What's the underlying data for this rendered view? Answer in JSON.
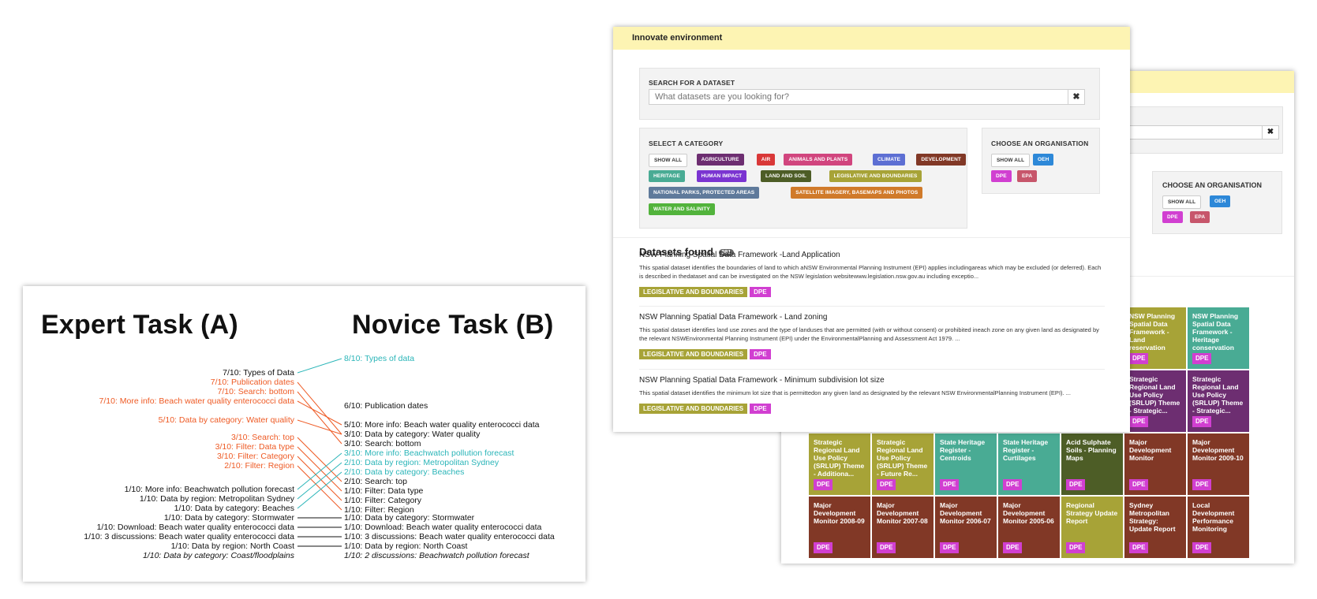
{
  "task_panel": {
    "expert_title": "Expert Task (A)",
    "novice_title": "Novice Task (B)",
    "colors": {
      "orange": "#ee5a24",
      "teal": "#2ab5b8",
      "black": "#111111"
    },
    "expert": [
      {
        "text": "7/10: Types of Data",
        "color": "black"
      },
      {
        "text": "7/10: Publication dates",
        "color": "orange"
      },
      {
        "text": "7/10: Search: bottom",
        "color": "orange"
      },
      {
        "text": "7/10: More info: Beach water quality enterococci data",
        "color": "orange"
      },
      {
        "text": "5/10: Data by category: Water quality",
        "color": "orange"
      },
      {
        "text": "3/10: Search: top",
        "color": "orange"
      },
      {
        "text": "3/10: Filter: Data type",
        "color": "orange"
      },
      {
        "text": "3/10: Filter: Category",
        "color": "orange"
      },
      {
        "text": "2/10: Filter: Region",
        "color": "orange"
      },
      {
        "text": "1/10: More info: Beachwatch pollution forecast",
        "color": "black"
      },
      {
        "text": "1/10: Data by region: Metropolitan Sydney",
        "color": "black"
      },
      {
        "text": "1/10: Data by category: Beaches",
        "color": "black"
      },
      {
        "text": "1/10: Data by category: Stormwater",
        "color": "black"
      },
      {
        "text": "1/10: Download: Beach water quality enterococci data",
        "color": "black"
      },
      {
        "text": "1/10: 3 discussions: Beach water quality enterococci data",
        "color": "black"
      },
      {
        "text": "1/10: Data by region: North Coast",
        "color": "black"
      },
      {
        "text": "1/10: Data by category: Coast/floodplains",
        "color": "black",
        "italic": true
      }
    ],
    "novice": [
      {
        "text": "8/10: Types of data",
        "color": "teal"
      },
      {
        "text": "6/10: Publication dates",
        "color": "black"
      },
      {
        "text": "5/10: More info: Beach water quality enterococci data",
        "color": "black"
      },
      {
        "text": "3/10: Data by category: Water quality",
        "color": "black"
      },
      {
        "text": "3/10: Search: bottom",
        "color": "black"
      },
      {
        "text": "3/10: More info: Beachwatch pollution forecast",
        "color": "teal"
      },
      {
        "text": "2/10: Data by region: Metropolitan Sydney",
        "color": "teal"
      },
      {
        "text": "2/10: Data by category: Beaches",
        "color": "teal"
      },
      {
        "text": "2/10: Search: top",
        "color": "black"
      },
      {
        "text": "1/10: Filter: Data type",
        "color": "black"
      },
      {
        "text": "1/10: Filter: Category",
        "color": "black"
      },
      {
        "text": "1/10: Filter: Region",
        "color": "black"
      },
      {
        "text": "1/10: Data by category: Stormwater",
        "color": "black"
      },
      {
        "text": "1/10: Download: Beach water quality enterococci data",
        "color": "black"
      },
      {
        "text": "1/10: 3 discussions: Beach water quality enterococci data",
        "color": "black"
      },
      {
        "text": "1/10: Data by region: North Coast",
        "color": "black"
      },
      {
        "text": "1/10: 2 discussions: Beachwatch pollution forecast",
        "color": "black",
        "italic": true
      }
    ],
    "connections": [
      {
        "from": 0,
        "to": 0,
        "color": "teal"
      },
      {
        "from": 1,
        "to": 3,
        "color": "orange"
      },
      {
        "from": 2,
        "to": 4,
        "color": "orange"
      },
      {
        "from": 3,
        "to": 2,
        "color": "orange"
      },
      {
        "from": 4,
        "to": 3,
        "color": "orange"
      },
      {
        "from": 5,
        "to": 8,
        "color": "orange"
      },
      {
        "from": 6,
        "to": 9,
        "color": "orange"
      },
      {
        "from": 7,
        "to": 10,
        "color": "orange"
      },
      {
        "from": 8,
        "to": 11,
        "color": "orange"
      },
      {
        "from": 9,
        "to": 5,
        "color": "teal"
      },
      {
        "from": 10,
        "to": 6,
        "color": "teal"
      },
      {
        "from": 11,
        "to": 7,
        "color": "teal"
      },
      {
        "from": 12,
        "to": 12,
        "color": "black"
      },
      {
        "from": 13,
        "to": 13,
        "color": "black"
      },
      {
        "from": 14,
        "to": 14,
        "color": "black"
      },
      {
        "from": 15,
        "to": 15,
        "color": "black"
      }
    ]
  },
  "front": {
    "header_title": "Innovate environment",
    "search_label": "SEARCH FOR A DATASET",
    "search_placeholder": "What datasets are you looking for?",
    "clear_icon": "✖",
    "category_label": "SELECT A CATEGORY",
    "categories": [
      {
        "label": "SHOW ALL",
        "color": "#ffffff",
        "outline": true
      },
      {
        "label": "AGRICULTURE",
        "color": "#6d2e71"
      },
      {
        "label": "AIR",
        "color": "#d93838"
      },
      {
        "label": "ANIMALS AND PLANTS",
        "color": "#d1457e"
      },
      {
        "label": "CLIMATE",
        "color": "#5d6fd3"
      },
      {
        "label": "DEVELOPMENT",
        "color": "#813826"
      },
      {
        "label": "HERITAGE",
        "color": "#49ab94"
      },
      {
        "label": "HUMAN IMPACT",
        "color": "#7b34d1"
      },
      {
        "label": "LAND AND SOIL",
        "color": "#4d5d26"
      },
      {
        "label": "LEGISLATIVE AND BOUNDARIES",
        "color": "#a7a337"
      },
      {
        "label": "NATIONAL PARKS, PROTECTED AREAS",
        "color": "#5f7a9b"
      },
      {
        "label": "SATELLITE IMAGERY, BASEMAPS AND PHOTOS",
        "color": "#d07a2a"
      },
      {
        "label": "WATER AND SALINITY",
        "color": "#52b33c"
      }
    ],
    "org_label": "CHOOSE AN ORGANISATION",
    "orgs": [
      {
        "label": "SHOW ALL",
        "color": "#ffffff",
        "outline": true
      },
      {
        "label": "OEH",
        "color": "#2d88d8"
      },
      {
        "label": "DPE",
        "color": "#d13fd1"
      },
      {
        "label": "EPA",
        "color": "#c7566b"
      }
    ],
    "datasets_heading": "Datasets found",
    "datasets_count": "981",
    "datasets": [
      {
        "title": "NSW Planning Spatial Data Framework -Land Application",
        "desc": "This spatial dataset identifies the boundaries of land to which aNSW Environmental Planning Instrument (EPI) applies includingareas which may be excluded (or deferred). Each is described in thedataset and can be investigated on the NSW legislation websitewww.legislation.nsw.gov.au including exceptio...",
        "tags": [
          {
            "label": "LEGISLATIVE AND BOUNDARIES",
            "color": "#a7a337"
          },
          {
            "label": "DPE",
            "color": "#d13fd1"
          }
        ]
      },
      {
        "title": "NSW Planning Spatial Data Framework - Land zoning",
        "desc": "This spatial dataset identifies land use zones and the type of landuses that are permitted (with or without consent) or prohibited ineach zone on any given land as designated by the relevant NSWEnvironmental Planning Instrument (EPI) under the EnvironmentalPlanning and Assessment Act 1979. ...",
        "tags": [
          {
            "label": "LEGISLATIVE AND BOUNDARIES",
            "color": "#a7a337"
          },
          {
            "label": "DPE",
            "color": "#d13fd1"
          }
        ]
      },
      {
        "title": "NSW Planning Spatial Data Framework - Minimum subdivision lot size",
        "desc": "This spatial dataset identifies the minimum lot size that is permittedon any given land as designated by the relevant NSW EnvironmentalPlanning Instrument (EPI). ...",
        "tags": [
          {
            "label": "LEGISLATIVE AND BOUNDARIES",
            "color": "#a7a337"
          },
          {
            "label": "DPE",
            "color": "#d13fd1"
          }
        ]
      }
    ]
  },
  "back": {
    "clear_icon": "✖",
    "org_label": "CHOOSE AN ORGANISATION",
    "orgs": [
      {
        "label": "SHOW ALL",
        "color": "#ffffff",
        "outline": true
      },
      {
        "label": "OEH",
        "color": "#2d88d8"
      },
      {
        "label": "DPE",
        "color": "#d13fd1"
      },
      {
        "label": "EPA",
        "color": "#c7566b"
      }
    ],
    "tiles": [
      {
        "row": 0,
        "col": 4,
        "title": "",
        "badge": "DPE",
        "color": "olive"
      },
      {
        "row": 0,
        "col": 5,
        "title": "NSW Planning Spatial Data Framework - Land reservation",
        "badge": "DPE",
        "color": "olive"
      },
      {
        "row": 0,
        "col": 6,
        "title": "NSW Planning Spatial Data Framework - Heritage conservation",
        "badge": "DPE",
        "color": "teal"
      },
      {
        "row": 1,
        "col": 5,
        "title": "Strategic Regional Land Use Policy (SRLUP) Theme - Strategic...",
        "badge": "DPE",
        "color": "purple"
      },
      {
        "row": 1,
        "col": 6,
        "title": "Strategic Regional Land Use Policy (SRLUP) Theme - Strategic...",
        "badge": "DPE",
        "color": "purple"
      },
      {
        "row": 2,
        "col": 0,
        "title": "Strategic Regional Land Use Policy (SRLUP) Theme - Additiona...",
        "badge": "DPE",
        "color": "olive"
      },
      {
        "row": 2,
        "col": 1,
        "title": "Strategic Regional Land Use Policy (SRLUP) Theme - Future Re...",
        "badge": "DPE",
        "color": "olive"
      },
      {
        "row": 2,
        "col": 2,
        "title": "State Heritage Register - Centroids",
        "badge": "DPE",
        "color": "teal"
      },
      {
        "row": 2,
        "col": 3,
        "title": "State Heritage Register - Curtilages",
        "badge": "DPE",
        "color": "teal"
      },
      {
        "row": 2,
        "col": 4,
        "title": "Acid Sulphate Soils - Planning Maps",
        "badge": "DPE",
        "color": "darkgreen"
      },
      {
        "row": 2,
        "col": 5,
        "title": "Major Development Monitor",
        "badge": "DPE",
        "color": "brown"
      },
      {
        "row": 2,
        "col": 6,
        "title": "Major Development Monitor 2009-10",
        "badge": "DPE",
        "color": "brown"
      },
      {
        "row": 3,
        "col": 0,
        "title": "Major Development Monitor 2008-09",
        "badge": "DPE",
        "color": "brown"
      },
      {
        "row": 3,
        "col": 1,
        "title": "Major Development Monitor 2007-08",
        "badge": "DPE",
        "color": "brown"
      },
      {
        "row": 3,
        "col": 2,
        "title": "Major Development Monitor 2006-07",
        "badge": "DPE",
        "color": "brown"
      },
      {
        "row": 3,
        "col": 3,
        "title": "Major Development Monitor 2005-06",
        "badge": "DPE",
        "color": "brown"
      },
      {
        "row": 3,
        "col": 4,
        "title": "Regional Strategy Update Report",
        "badge": "DPE",
        "color": "olive"
      },
      {
        "row": 3,
        "col": 5,
        "title": "Sydney Metropolitan Strategy: Update Report",
        "badge": "DPE",
        "color": "brown"
      },
      {
        "row": 3,
        "col": 6,
        "title": "Local Development Performance Monitoring",
        "badge": "DPE",
        "color": "brown"
      }
    ]
  }
}
